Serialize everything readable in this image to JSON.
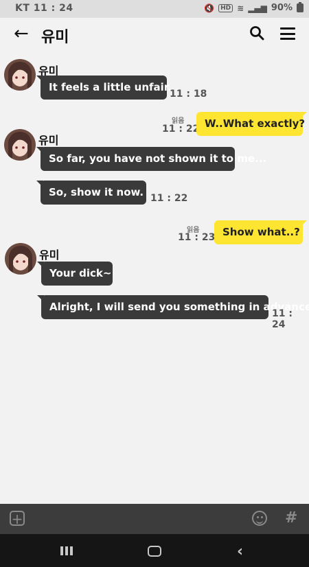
{
  "status": {
    "carrier": "KT",
    "time": "11 : 24",
    "battery": "90%",
    "hd": "HD"
  },
  "header": {
    "title": "유미"
  },
  "contact_name": "유미",
  "read_label": "읽음",
  "messages": [
    {
      "text": "It feels a little unfair...",
      "time": "11 : 18"
    },
    {
      "text": "W..What exactly?",
      "time": "11 : 22"
    },
    {
      "text": "So far, you have not shown it to me...",
      "time": ""
    },
    {
      "text": "So, show it now.",
      "time": "11 : 22"
    },
    {
      "text": "Show what..?",
      "time": "11 : 23"
    },
    {
      "text": "Your dick~",
      "time": ""
    },
    {
      "text": "Alright, I will send you something in advance~",
      "time": "11 : 24"
    }
  ],
  "input": {
    "hash": "#"
  },
  "colors": {
    "sent": "#fde532",
    "received": "#3a3a3a",
    "background": "#f2f2f2"
  }
}
